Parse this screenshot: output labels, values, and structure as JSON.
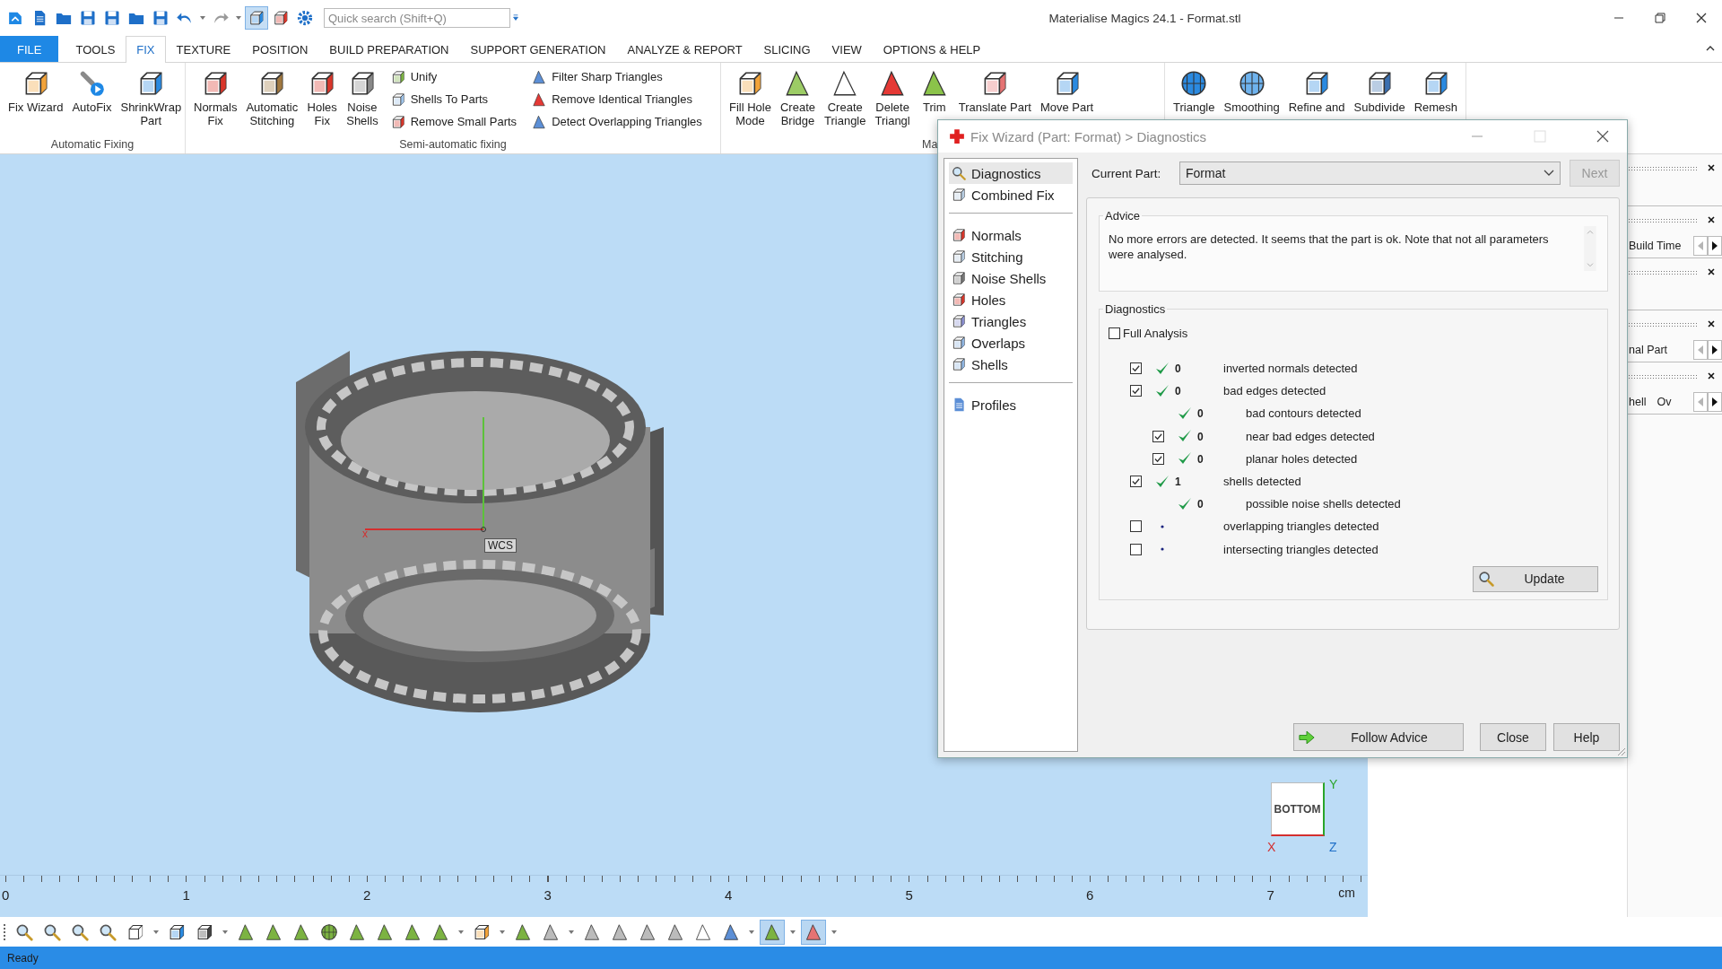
{
  "window": {
    "title": "Materialise Magics 24.1 - Format.stl"
  },
  "quick_access": [
    {
      "selected": false
    },
    {
      "selected": false
    },
    {
      "selected": false
    },
    {
      "selected": false
    },
    {
      "selected": false
    },
    {
      "selected": false
    },
    {
      "selected": false
    },
    {
      "selected": false
    },
    {
      "selected": false
    },
    {
      "selected": true
    },
    {
      "selected": false
    },
    {
      "selected": false
    }
  ],
  "quick_search": {
    "placeholder": "Quick search (Shift+Q)"
  },
  "tabs": [
    {
      "label": "FILE",
      "kind": "file",
      "selected": false
    },
    {
      "label": "TOOLS",
      "kind": "tab",
      "selected": false
    },
    {
      "label": "FIX",
      "kind": "tab",
      "selected": true
    },
    {
      "label": "TEXTURE",
      "kind": "tab",
      "selected": false
    },
    {
      "label": "POSITION",
      "kind": "tab",
      "selected": false
    },
    {
      "label": "BUILD PREPARATION",
      "kind": "tab",
      "selected": false
    },
    {
      "label": "SUPPORT GENERATION",
      "kind": "tab",
      "selected": false
    },
    {
      "label": "ANALYZE & REPORT",
      "kind": "tab",
      "selected": false
    },
    {
      "label": "SLICING",
      "kind": "tab",
      "selected": false
    },
    {
      "label": "VIEW",
      "kind": "tab",
      "selected": false
    },
    {
      "label": "OPTIONS & HELP",
      "kind": "tab",
      "selected": false
    }
  ],
  "ribbon_groups": [
    {
      "label": "Automatic Fixing",
      "items": [
        {
          "kind": "large",
          "label": "Fix Wizard"
        },
        {
          "kind": "large",
          "label": "AutoFix"
        },
        {
          "kind": "large",
          "label": "ShrinkWrap\nPart"
        }
      ]
    },
    {
      "label": "Semi-automatic fixing",
      "items": [
        {
          "kind": "large",
          "label": "Normals\nFix"
        },
        {
          "kind": "large",
          "label": "Automatic\nStitching"
        },
        {
          "kind": "large",
          "label": "Holes\nFix"
        },
        {
          "kind": "large",
          "label": "Noise\nShells"
        },
        {
          "kind": "column",
          "entries": [
            {
              "label": "Unify"
            },
            {
              "label": "Shells To Parts"
            },
            {
              "label": "Remove Small Parts"
            }
          ]
        },
        {
          "kind": "column",
          "entries": [
            {
              "label": "Filter Sharp Triangles"
            },
            {
              "label": "Remove Identical Triangles"
            },
            {
              "label": "Detect Overlapping Triangles"
            }
          ]
        }
      ]
    },
    {
      "label": "Ma",
      "items": [
        {
          "kind": "large",
          "label": "Fill Hole\nMode"
        },
        {
          "kind": "large",
          "label": "Create\nBridge"
        },
        {
          "kind": "large",
          "label": "Create\nTriangle"
        },
        {
          "kind": "large",
          "label": "Delete\nTriangl"
        },
        {
          "kind": "large",
          "label": "Trim"
        },
        {
          "kind": "large",
          "label": "Translate Part"
        },
        {
          "kind": "large",
          "label": "Move Part"
        }
      ]
    },
    {
      "items": [
        {
          "kind": "large",
          "label": "Triangle"
        },
        {
          "kind": "large",
          "label": "Smoothing"
        },
        {
          "kind": "large",
          "label": "Refine and"
        },
        {
          "kind": "large",
          "label": "Subdivide"
        },
        {
          "kind": "large",
          "label": "Remesh"
        }
      ]
    }
  ],
  "viewport": {
    "axis_label": "x",
    "wcs_label": "WCS",
    "view_cube": {
      "face": "BOTTOM",
      "axes": [
        "Y",
        "X",
        "Z"
      ]
    }
  },
  "ruler": {
    "labels": [
      "0",
      "1",
      "2",
      "3",
      "4",
      "5",
      "6",
      "7"
    ],
    "unit": "cm"
  },
  "dock_panels": [
    {
      "kind": "empty"
    },
    {
      "kind": "row",
      "labels": [
        "Build Time"
      ],
      "left_disabled": true
    },
    {
      "kind": "empty"
    },
    {
      "kind": "row",
      "labels": [
        "nal Part"
      ],
      "left_disabled": true
    },
    {
      "kind": "row",
      "labels": [
        "hell",
        "Ov"
      ],
      "left_disabled": true
    }
  ],
  "dialog": {
    "title": "Fix Wizard (Part: Format) > Diagnostics",
    "nav_groups": [
      {
        "items": [
          {
            "label": "Diagnostics",
            "selected": true
          },
          {
            "label": "Combined Fix",
            "selected": false
          }
        ]
      },
      {
        "items": [
          {
            "label": "Normals",
            "selected": false
          },
          {
            "label": "Stitching",
            "selected": false
          },
          {
            "label": "Noise Shells",
            "selected": false
          },
          {
            "label": "Holes",
            "selected": false
          },
          {
            "label": "Triangles",
            "selected": false
          },
          {
            "label": "Overlaps",
            "selected": false
          },
          {
            "label": "Shells",
            "selected": false
          }
        ]
      },
      {
        "items": [
          {
            "label": "Profiles",
            "selected": false
          }
        ]
      }
    ],
    "current_part": {
      "label": "Current Part:",
      "value": "Format"
    },
    "next_button": {
      "label": "Next",
      "disabled": true
    },
    "advice": {
      "title": "Advice",
      "text": "No more errors are detected. It seems that the part is ok. Note that not all parameters were analysed."
    },
    "diagnostics": {
      "title": "Diagnostics",
      "full_analysis": {
        "label": "Full Analysis",
        "checked": false
      },
      "rows": [
        {
          "kind": "checkbox",
          "checked": true,
          "passed": true,
          "count": "0",
          "label": "inverted normals detected"
        },
        {
          "kind": "checkbox",
          "checked": true,
          "passed": true,
          "count": "0",
          "label": "bad edges detected",
          "children": [
            {
              "kind": "plain",
              "passed": true,
              "count": "0",
              "label": "bad contours detected"
            },
            {
              "kind": "checkbox",
              "checked": true,
              "passed": true,
              "count": "0",
              "label": "near bad edges detected"
            },
            {
              "kind": "checkbox",
              "checked": true,
              "passed": true,
              "count": "0",
              "label": "planar holes detected"
            }
          ]
        },
        {
          "kind": "checkbox",
          "checked": true,
          "passed": true,
          "count": "1",
          "label": "shells detected",
          "children": [
            {
              "kind": "plain",
              "passed": true,
              "count": "0",
              "label": "possible noise shells detected"
            }
          ]
        },
        {
          "kind": "checkbox",
          "checked": false,
          "passed": false,
          "label": "overlapping triangles detected"
        },
        {
          "kind": "checkbox",
          "checked": false,
          "passed": false,
          "label": "intersecting triangles detected"
        }
      ]
    },
    "update_button": "Update",
    "buttons": [
      {
        "kind": "follow",
        "label": "Follow Advice"
      },
      {
        "kind": "plain",
        "label": "Close"
      },
      {
        "kind": "plain",
        "label": "Help"
      }
    ]
  },
  "bottom_toolbar": [
    {
      "selected": false
    },
    {
      "selected": false
    },
    {
      "selected": false
    },
    {
      "selected": false
    },
    {
      "selected": false
    },
    {
      "selected": false
    },
    {
      "selected": false
    },
    {
      "selected": false
    },
    {
      "selected": false
    },
    {
      "selected": false
    },
    {
      "selected": false
    },
    {
      "selected": false
    },
    {
      "selected": false
    },
    {
      "selected": false
    },
    {
      "selected": false
    },
    {
      "selected": false
    },
    {
      "selected": false
    },
    {
      "selected": false
    },
    {
      "selected": false
    },
    {
      "selected": false
    },
    {
      "selected": false
    },
    {
      "selected": false
    },
    {
      "selected": false
    },
    {
      "selected": false
    },
    {
      "selected": true
    },
    {
      "selected": true
    }
  ],
  "status_bar": {
    "text": "Ready"
  }
}
